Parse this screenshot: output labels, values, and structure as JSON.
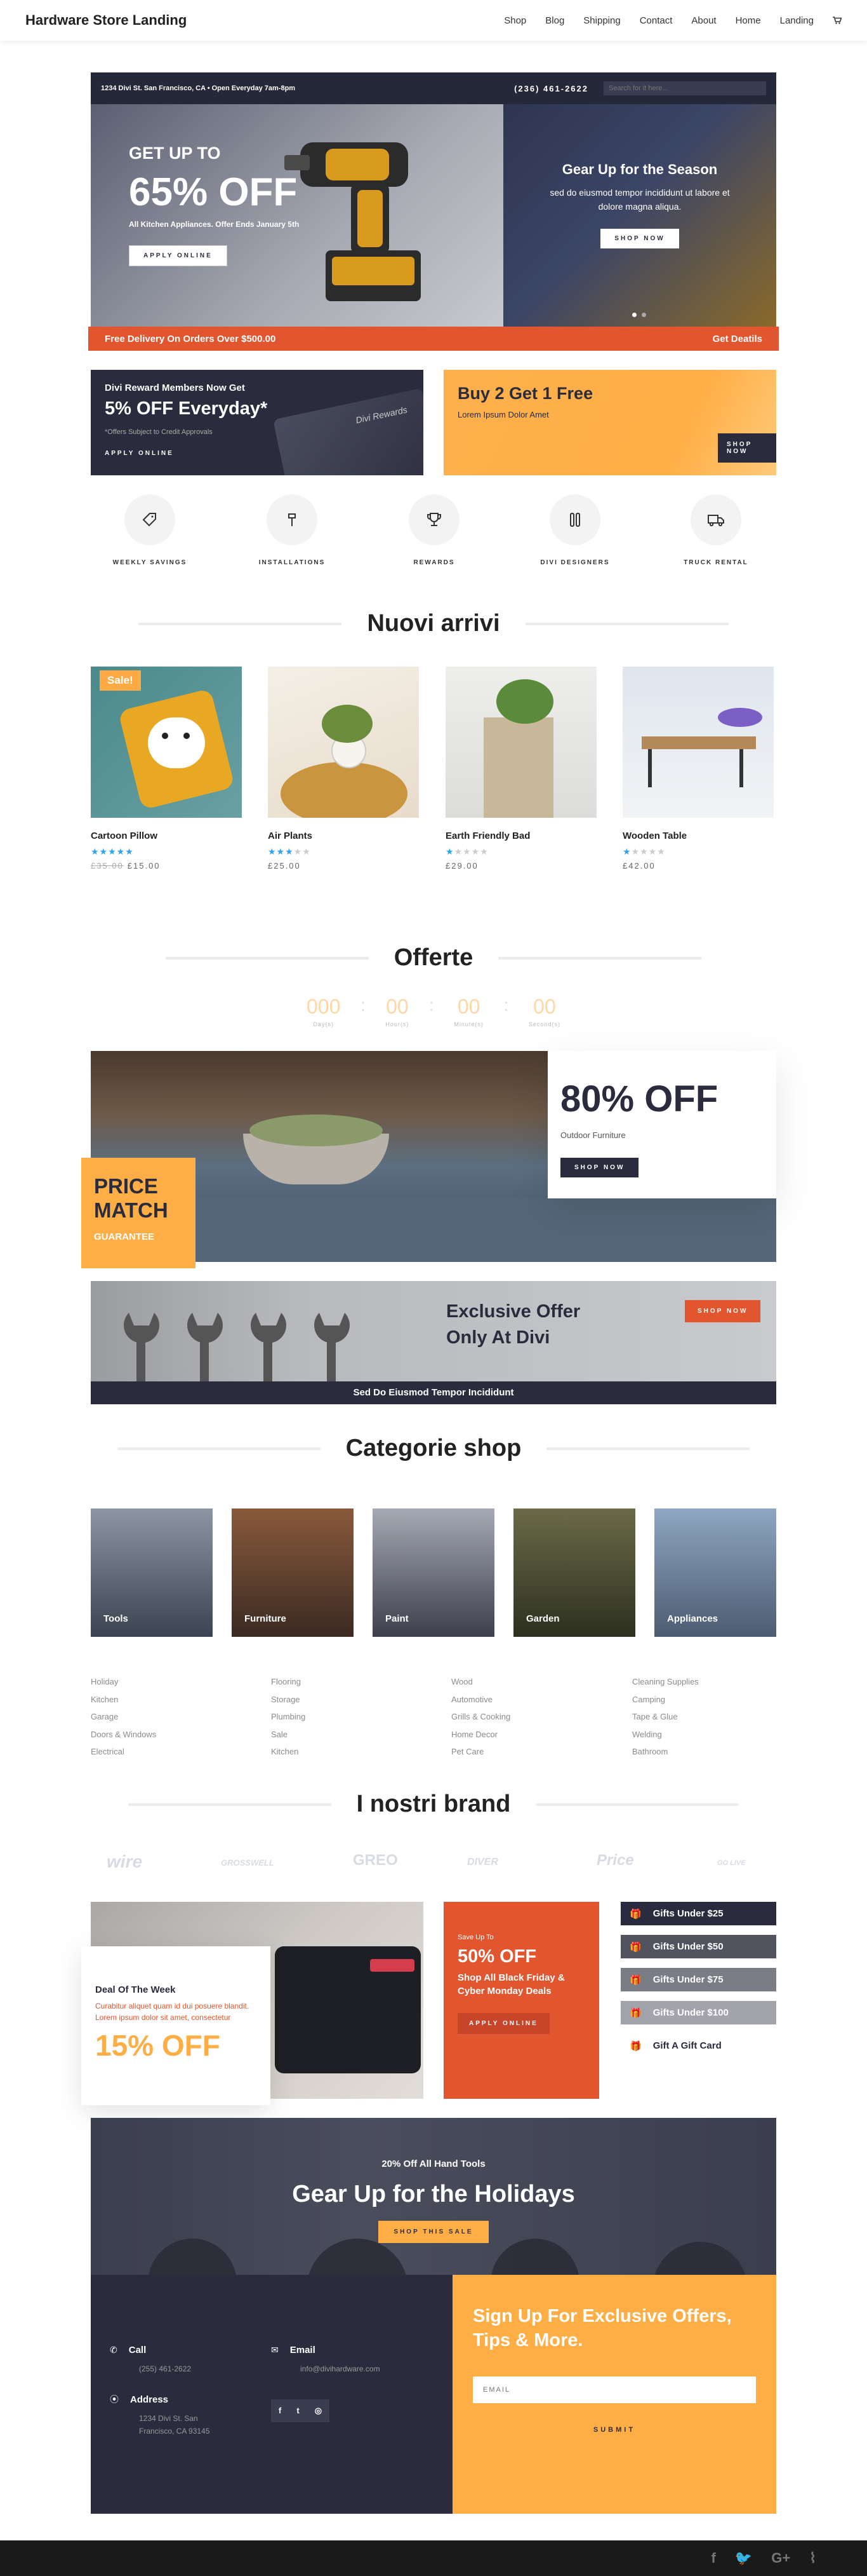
{
  "header": {
    "logo": "Hardware Store Landing",
    "nav": [
      "Shop",
      "Blog",
      "Shipping",
      "Contact",
      "About",
      "Home",
      "Landing"
    ]
  },
  "hero": {
    "address": "1234 Divi St. San Francisco, CA • Open Everyday 7am-8pm",
    "phone": "(236) 461-2622",
    "search_placeholder": "Search for it here...",
    "left": {
      "kicker": "GET UP TO",
      "headline": "65% OFF",
      "sub": "All Kitchen Appliances. Offer Ends January 5th",
      "button": "APPLY ONLINE"
    },
    "right": {
      "title": "Gear Up for the Season",
      "body": "sed do eiusmod tempor incididunt ut labore et dolore magna aliqua.",
      "button": "SHOP NOW"
    },
    "promo_left": "Free Delivery On Orders Over $500.00",
    "promo_right": "Get Deatils"
  },
  "cards": {
    "reward": {
      "kicker": "Divi Reward Members Now Get",
      "headline": "5% OFF Everyday*",
      "note": "*Offers Subject to Credit Approvals",
      "button": "APPLY ONLINE",
      "card_text": "Divi Rewards"
    },
    "bogo": {
      "headline": "Buy 2 Get 1 Free",
      "sub": "Lorem Ipsum Dolor Amet",
      "button": "SHOP NOW"
    }
  },
  "services": [
    {
      "label": "WEEKLY SAVINGS",
      "icon": "tag-icon"
    },
    {
      "label": "INSTALLATIONS",
      "icon": "hammer-icon"
    },
    {
      "label": "REWARDS",
      "icon": "trophy-icon"
    },
    {
      "label": "DIVI DESIGNERS",
      "icon": "tools-icon"
    },
    {
      "label": "TRUCK RENTAL",
      "icon": "truck-icon"
    }
  ],
  "new_arrivals": {
    "title": "Nuovi arrivi",
    "products": [
      {
        "name": "Cartoon Pillow",
        "stars": 5,
        "old_price": "£35.00",
        "price": "£15.00",
        "sale": "Sale!"
      },
      {
        "name": "Air Plants",
        "stars": 3,
        "price": "£25.00"
      },
      {
        "name": "Earth Friendly Bad",
        "stars": 1,
        "price": "£29.00"
      },
      {
        "name": "Wooden Table",
        "stars": 1,
        "price": "£42.00"
      }
    ]
  },
  "offers": {
    "title": "Offerte",
    "countdown": [
      {
        "value": "000",
        "unit": "Day(s)"
      },
      {
        "value": "00",
        "unit": "Hour(s)"
      },
      {
        "value": "00",
        "unit": "Minute(s)"
      },
      {
        "value": "00",
        "unit": "Second(s)"
      }
    ],
    "big": {
      "headline": "80% OFF",
      "sub": "Outdoor Furniture",
      "button": "SHOP NOW"
    },
    "price_match": {
      "line1": "PRICE",
      "line2": "MATCH",
      "line3": "GUARANTEE"
    },
    "exclusive": {
      "line1": "Exclusive Offer",
      "line2": "Only At Divi",
      "button": "SHOP NOW",
      "bar": "Sed Do Eiusmod Tempor Incididunt"
    }
  },
  "categories": {
    "title": "Categorie shop",
    "tiles": [
      "Tools",
      "Furniture",
      "Paint",
      "Garden",
      "Appliances"
    ],
    "lists": [
      [
        "Holiday",
        "Kitchen",
        "Garage",
        "Doors & Windows",
        "Electrical"
      ],
      [
        "Flooring",
        "Storage",
        "Plumbing",
        "Sale",
        "Kitchen"
      ],
      [
        "Wood",
        "Automotive",
        "Grills & Cooking",
        "Home Decor",
        "Pet Care"
      ],
      [
        "Cleaning Supplies",
        "Camping",
        "Tape & Glue",
        "Welding",
        "Bathroom"
      ]
    ]
  },
  "brands": {
    "title": "I nostri brand",
    "items": [
      "wire",
      "GROSSWELL",
      "GREO",
      "DIVER",
      "Price",
      "GO LIVE"
    ]
  },
  "deal": {
    "kicker": "Deal Of The Week",
    "body": "Curabitur aliquet quam id dui posuere blandit. Lorem ipsum dolor sit amet, consectetur",
    "headline": "15% OFF"
  },
  "black_friday": {
    "kicker": "Save Up To",
    "headline": "50% OFF",
    "sub": "Shop All Black Friday & Cyber Monday Deals",
    "button": "APPLY ONLINE"
  },
  "gifts": [
    "Gifts Under $25",
    "Gifts Under $50",
    "Gifts Under $75",
    "Gifts Under $100",
    "Gift A Gift Card"
  ],
  "holiday": {
    "kicker": "20% Off All Hand Tools",
    "headline": "Gear Up for the Holidays",
    "button": "SHOP THIS SALE"
  },
  "footer": {
    "call_label": "Call",
    "call_value": "(255) 461-2622",
    "email_label": "Email",
    "email_value": "info@divihardware.com",
    "address_label": "Address",
    "address_value": "1234 Divi St. San Francisco, CA 93145",
    "signup_title": "Sign Up For Exclusive Offers, Tips & More.",
    "email_placeholder": "EMAIL",
    "submit": "SUBMIT",
    "social": [
      "facebook-icon",
      "twitter-icon",
      "instagram-icon"
    ],
    "bottom_social": [
      "f",
      "twitter",
      "G+",
      "rss"
    ]
  },
  "colors": {
    "navy": "#2a2c3d",
    "orange": "#e1552f",
    "amber": "#ffae45",
    "blue_star": "#2ea3f2"
  }
}
